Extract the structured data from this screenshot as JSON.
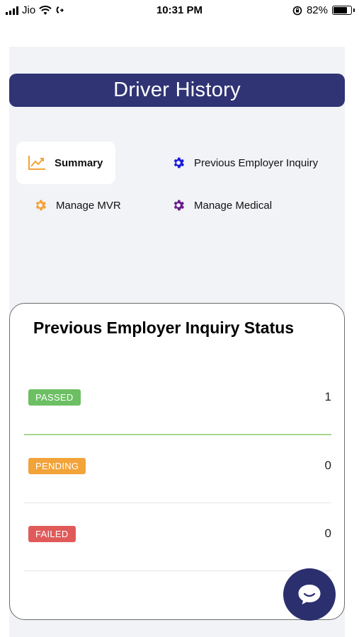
{
  "status_bar": {
    "carrier": "Jio",
    "time": "10:31 PM",
    "battery_percent": "82%",
    "battery_level": 0.82
  },
  "header": {
    "title": "Driver History"
  },
  "nav": {
    "items": [
      {
        "label": "Summary",
        "icon": "chart-line-icon",
        "color": "#f2a33a",
        "active": true
      },
      {
        "label": "Previous Employer Inquiry",
        "icon": "gear-icon",
        "color": "#1a1adb",
        "active": false
      },
      {
        "label": "Manage MVR",
        "icon": "gear-icon",
        "color": "#f2a33a",
        "active": false
      },
      {
        "label": "Manage Medical",
        "icon": "gear-icon",
        "color": "#6a1b8a",
        "active": false
      }
    ]
  },
  "status_card": {
    "title": "Previous Employer Inquiry Status",
    "rows": [
      {
        "label": "PASSED",
        "count": "1",
        "color": "#6cbf63"
      },
      {
        "label": "PENDING",
        "count": "0",
        "color": "#f2a33a"
      },
      {
        "label": "FAILED",
        "count": "0",
        "color": "#e05a5a"
      }
    ]
  },
  "colors": {
    "header_bg": "#303475",
    "app_bg": "#f1f3f6",
    "chat_bg": "#2c2f6e"
  },
  "chat": {
    "icon": "chat-bubble-icon"
  }
}
